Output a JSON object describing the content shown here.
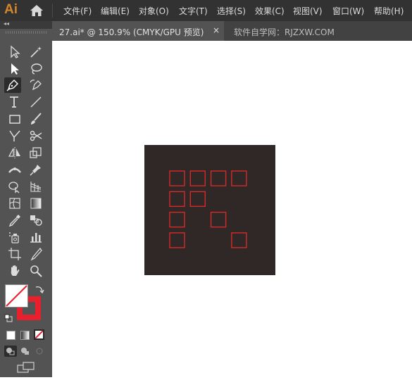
{
  "app": {
    "logo": "Ai"
  },
  "menu": [
    "文件(F)",
    "编辑(E)",
    "对象(O)",
    "文字(T)",
    "选择(S)",
    "效果(C)",
    "视图(V)",
    "窗口(W)",
    "帮助(H)"
  ],
  "tabs": {
    "active": "27.ai* @ 150.9% (CMYK/GPU 预览)",
    "close_glyph": "×",
    "inactive": "软件自学网：RJZXW.COM"
  },
  "toolbar": {
    "collapse_glyph": "◂◂"
  },
  "artwork": {
    "background_color": "#302826",
    "square_stroke_color": "#d42a2a",
    "squares_grid": [
      [
        1,
        1,
        1,
        1
      ],
      [
        1,
        1,
        0,
        0
      ],
      [
        1,
        0,
        1,
        0
      ],
      [
        1,
        0,
        0,
        1
      ]
    ]
  },
  "colors": {
    "stroke_swatch": "#e8202e",
    "fill_swatch": "none"
  }
}
